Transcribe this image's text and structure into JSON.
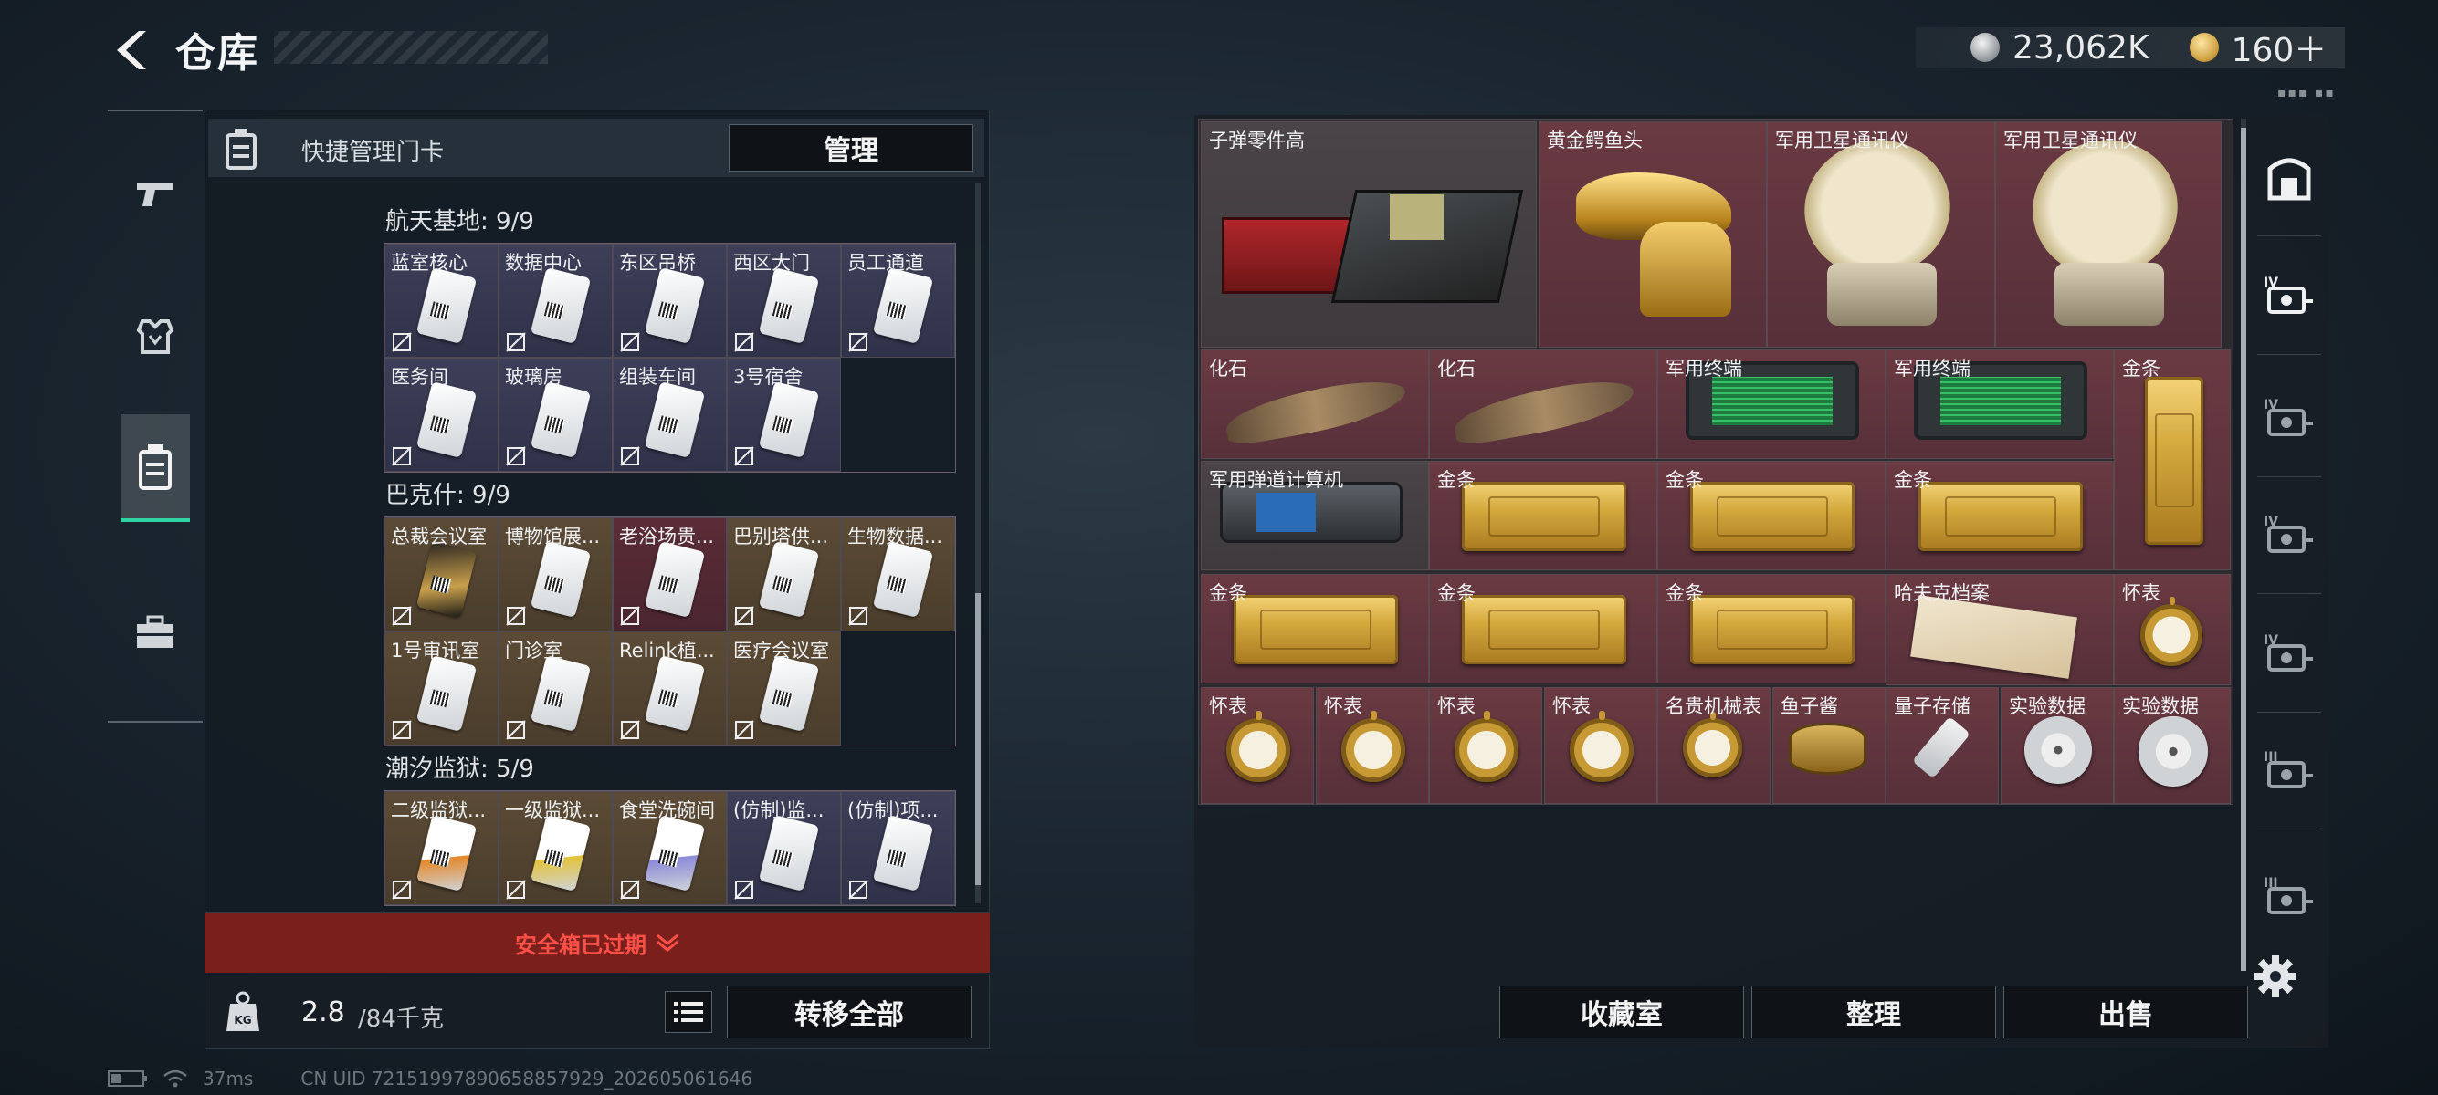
{
  "header": {
    "title": "仓库",
    "currency_silver": "23,062K",
    "currency_gold": "160＋"
  },
  "left_tabs": [
    {
      "name": "weapons-icon"
    },
    {
      "name": "armor-icon"
    },
    {
      "name": "keycard-icon",
      "active": true
    },
    {
      "name": "briefcase-icon"
    }
  ],
  "quick_bar": {
    "label": "快捷管理门卡",
    "manage_label": "管理"
  },
  "sections": [
    {
      "title": "航天基地: 9/9",
      "color": "blue",
      "cards": [
        {
          "label": "蓝室核心"
        },
        {
          "label": "数据中心"
        },
        {
          "label": "东区吊桥"
        },
        {
          "label": "西区大门"
        },
        {
          "label": "员工通道"
        },
        {
          "label": "医务间"
        },
        {
          "label": "玻璃房"
        },
        {
          "label": "组装车间"
        },
        {
          "label": "3号宿舍"
        }
      ]
    },
    {
      "title": "巴克什: 9/9",
      "color": "gold",
      "cards": [
        {
          "label": "总裁会议室",
          "variant": "gold"
        },
        {
          "label": "博物馆展..."
        },
        {
          "label": "老浴场贵...",
          "bg": "red"
        },
        {
          "label": "巴别塔供..."
        },
        {
          "label": "生物数据..."
        },
        {
          "label": "1号审讯室"
        },
        {
          "label": "门诊室"
        },
        {
          "label": "Relink植..."
        },
        {
          "label": "医疗会议室"
        }
      ]
    },
    {
      "title": "潮汐监狱: 5/9",
      "color": "gold",
      "cards": [
        {
          "label": "二级监狱...",
          "variant": "orange"
        },
        {
          "label": "一级监狱...",
          "variant": "yellow"
        },
        {
          "label": "食堂洗碗间",
          "variant": "purple"
        },
        {
          "label": "(仿制)监...",
          "bg": "blue"
        },
        {
          "label": "(仿制)项...",
          "bg": "blue"
        }
      ]
    }
  ],
  "expired_label": "安全箱已过期",
  "weight": {
    "current": "2.8",
    "max": "/84千克"
  },
  "transfer_all_label": "转移全部",
  "stash_items": [
    {
      "label": "子弹零件高",
      "kind": "ammo-crate",
      "bg": "g"
    },
    {
      "label": "黄金鳄鱼头",
      "kind": "croc-head",
      "bg": "r"
    },
    {
      "label": "军用卫星通讯仪",
      "kind": "dish",
      "bg": "r"
    },
    {
      "label": "军用卫星通讯仪",
      "kind": "dish",
      "bg": "r"
    },
    {
      "label": "化石",
      "kind": "fossil",
      "bg": "r"
    },
    {
      "label": "化石",
      "kind": "fossil",
      "bg": "r"
    },
    {
      "label": "军用终端",
      "kind": "terminal",
      "bg": "r"
    },
    {
      "label": "军用终端",
      "kind": "terminal",
      "bg": "r"
    },
    {
      "label": "金条",
      "kind": "gold-vertical",
      "bg": "r"
    },
    {
      "label": "军用弹道计算机",
      "kind": "computer",
      "bg": "g"
    },
    {
      "label": "金条",
      "kind": "gold-bar",
      "bg": "r"
    },
    {
      "label": "金条",
      "kind": "gold-bar",
      "bg": "r"
    },
    {
      "label": "金条",
      "kind": "gold-bar",
      "bg": "r"
    },
    {
      "label": "金条",
      "kind": "gold-bar",
      "bg": "r"
    },
    {
      "label": "金条",
      "kind": "gold-bar",
      "bg": "r"
    },
    {
      "label": "金条",
      "kind": "gold-bar",
      "bg": "r"
    },
    {
      "label": "哈夫克档案",
      "kind": "documents",
      "bg": "r"
    },
    {
      "label": "怀表",
      "kind": "watch",
      "bg": "r"
    },
    {
      "label": "怀表",
      "kind": "watch",
      "bg": "r"
    },
    {
      "label": "怀表",
      "kind": "watch",
      "bg": "r"
    },
    {
      "label": "怀表",
      "kind": "watch",
      "bg": "r"
    },
    {
      "label": "怀表",
      "kind": "watch",
      "bg": "r"
    },
    {
      "label": "名贵机械表",
      "kind": "wristwatch",
      "bg": "r"
    },
    {
      "label": "鱼子酱",
      "kind": "caviar",
      "bg": "r"
    },
    {
      "label": "量子存储",
      "kind": "usb",
      "bg": "r"
    },
    {
      "label": "实验数据",
      "kind": "disc",
      "bg": "r"
    },
    {
      "label": "实验数据",
      "kind": "disc",
      "bg": "r"
    }
  ],
  "right_tabs": [
    {
      "name": "container-icon"
    },
    {
      "name": "iv-safe-icon",
      "text": "IV"
    },
    {
      "name": "iv-case-icon",
      "text": "IV"
    },
    {
      "name": "iv-medical-icon",
      "text": "IV"
    },
    {
      "name": "iv-folder-icon",
      "text": "IV"
    },
    {
      "name": "iii-box-icon",
      "text": "III"
    },
    {
      "name": "iii-case-icon",
      "text": "III"
    }
  ],
  "bottom_buttons": {
    "collection": "收藏室",
    "sort": "整理",
    "sell": "出售"
  },
  "status_bar": {
    "ping": "37ms",
    "uid": "CN UID 7215199789065885792​9_202605061646"
  }
}
